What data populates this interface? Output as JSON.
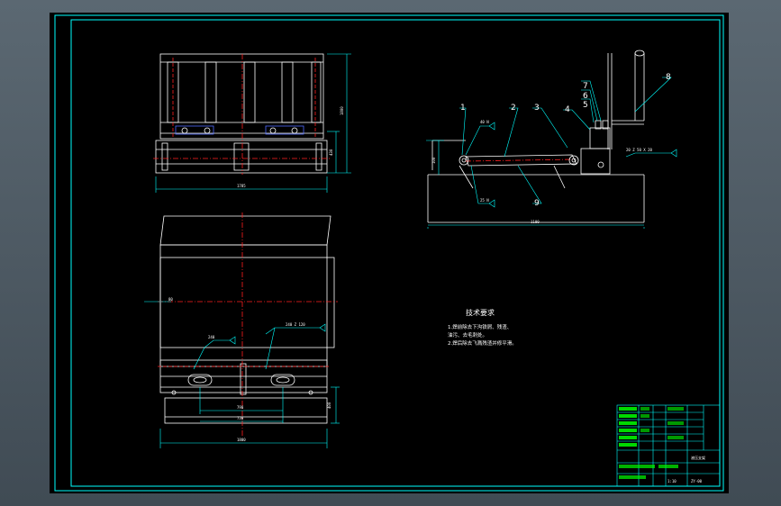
{
  "colors": {
    "background": "#4c5862",
    "sheet": "#000000",
    "frame": "#00ffff",
    "outline": "#ffffff",
    "centerline": "#ff2020",
    "dimension": "#00ffff",
    "title_block_text": "#00ff00"
  },
  "balloons": [
    "1",
    "2",
    "3",
    "4",
    "5",
    "6",
    "7",
    "8",
    "9"
  ],
  "notes": {
    "heading": "技术要求",
    "lines": [
      "1.焊前除去下沟铁屑、残渣、",
      "油污、去毛刺处。",
      "2.焊后除去飞溅残渣并修平滑。"
    ]
  },
  "title_block": {
    "drawing_name": "液压支架",
    "drawing_no": "ZY-00",
    "scale": "1:10"
  }
}
